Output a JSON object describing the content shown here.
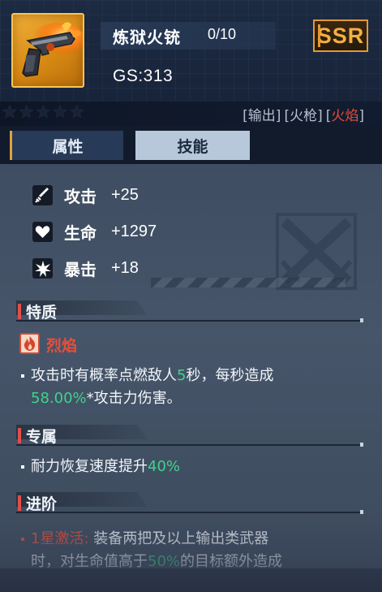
{
  "header": {
    "weapon_name": "炼狱火铳",
    "level": "0/10",
    "gs": "GS:313",
    "rarity": "SSR",
    "image_alt": "flame-pistol-icon"
  },
  "stars": {
    "filled": 0,
    "total": 5,
    "glyph": "★"
  },
  "tags": [
    {
      "label": "输出",
      "color": "#b6c0cc"
    },
    {
      "label": "火枪",
      "color": "#b6c0cc"
    },
    {
      "label": "火焰",
      "color": "#e64c3a"
    }
  ],
  "tabs": {
    "attributes": "属性",
    "skills": "技能",
    "active": "attributes"
  },
  "stats": [
    {
      "label": "攻击",
      "value": "+25",
      "icon": "sword-icon"
    },
    {
      "label": "生命",
      "value": "+1297",
      "icon": "heart-icon"
    },
    {
      "label": "暴击",
      "value": "+18",
      "icon": "burst-icon"
    }
  ],
  "sections": {
    "trait": {
      "title": "特质",
      "name": "烈焰",
      "icon": "flame-icon",
      "desc_line1_a": "攻击时有概率点燃敌人",
      "desc_line1_b": "5",
      "desc_line1_c": "秒，每秒造成",
      "desc_line2_a": "58.00%",
      "desc_line2_b": "*攻击力伤害。"
    },
    "exclusive": {
      "title": "专属",
      "desc_a": "耐力恢复速度提升",
      "desc_b": "40%"
    },
    "advance": {
      "title": "进阶",
      "desc_line1_a": "1星激活:",
      "desc_line1_b": "装备两把及以上输出类武器",
      "desc_line2_a": "时，对生命值高于",
      "desc_line2_b": "50%",
      "desc_line2_c": "的目标额外造成"
    }
  },
  "colors": {
    "accent_gold": "#f5b042",
    "highlight_green": "#3fd38a",
    "fire_red": "#e5503c",
    "panel_bg": "#465569",
    "header_bg": "#1c2a42"
  }
}
